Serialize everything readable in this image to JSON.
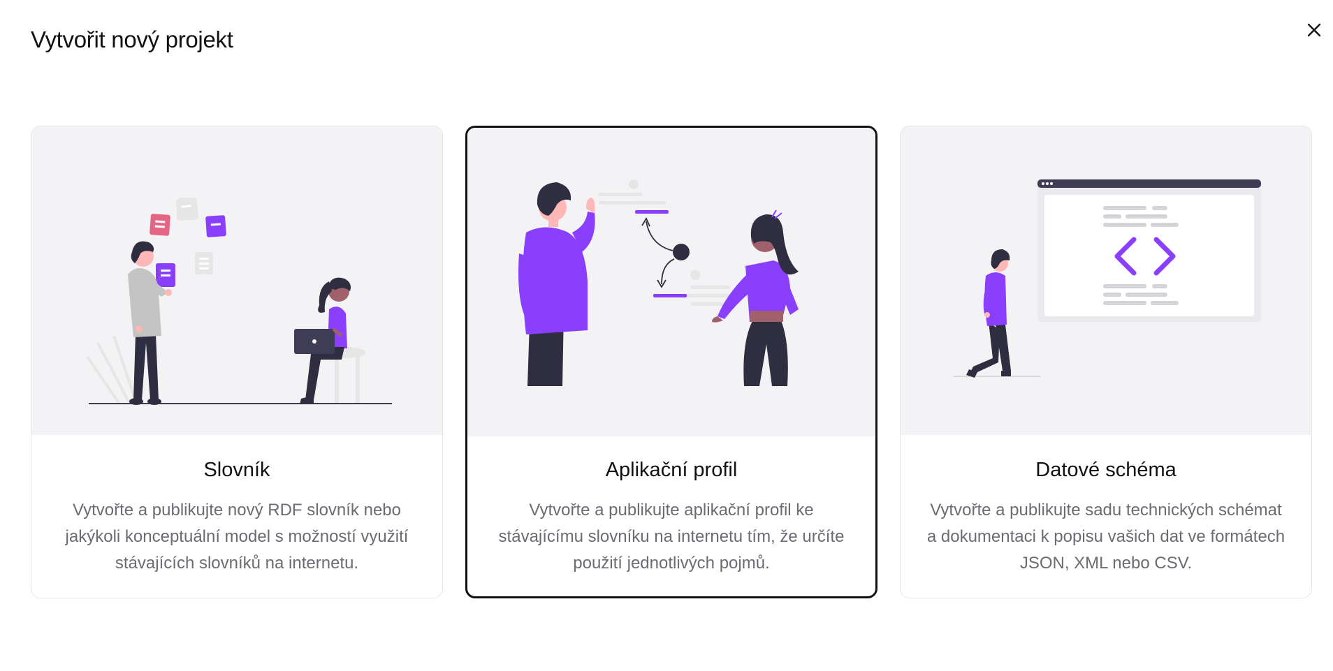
{
  "dialog": {
    "title": "Vytvořit nový projekt",
    "close_icon": "close-icon"
  },
  "cards": [
    {
      "title": "Slovník",
      "description": "Vytvořte a publikujte nový RDF slovník nebo jakýkoli konceptuální model s možností využití stávajících slovníků na internetu.",
      "illustration": "team-collaboration-illustration",
      "selected": false
    },
    {
      "title": "Aplikační profil",
      "description": "Vytvořte a publikujte aplikační profil ke stávajícímu slovníku na internetu tím, že určíte použití jednotlivých pojmů.",
      "illustration": "mapping-concepts-illustration",
      "selected": true
    },
    {
      "title": "Datové schéma",
      "description": "Vytvořte a publikujte sadu technických schémat a dokumentaci k popisu vašich dat ve formátech JSON, XML nebo CSV.",
      "illustration": "code-browser-illustration",
      "selected": false
    }
  ],
  "colors": {
    "accent": "#8a3ffc",
    "accent_dark": "#7c3aed",
    "pink": "#e36583",
    "dark": "#2f2e41",
    "skin_light": "#ffb8b8",
    "skin_dark": "#a0616a",
    "grey_shirt": "#c4c4c4",
    "illustration_bg": "#f3f3f5",
    "selected_border": "#111111",
    "text_muted": "#6b6b72"
  }
}
